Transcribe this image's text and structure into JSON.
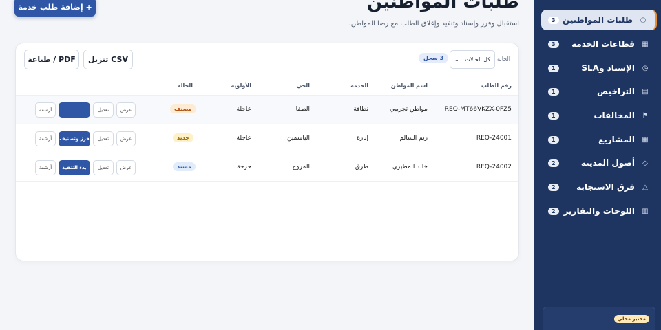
{
  "header": {
    "add_button": "+ إضافة طلب خدمة",
    "title": "طلبات المواطنين",
    "subtitle": "استقبال وفرز وإسناد وتنفيذ وإغلاق الطلب مع رضا المواطن."
  },
  "sidebar": {
    "items": [
      {
        "label": "طلبات المواطنين",
        "count": "3",
        "icon": "circle-icon",
        "glyph": "○"
      },
      {
        "label": "قطاعات الخدمة",
        "count": "3",
        "icon": "grid-icon",
        "glyph": "▦"
      },
      {
        "label": "الإسناد وSLA",
        "count": "1",
        "icon": "clock-icon",
        "glyph": "◷"
      },
      {
        "label": "التراخيص",
        "count": "1",
        "icon": "license-icon",
        "glyph": "▤"
      },
      {
        "label": "المخالفات",
        "count": "1",
        "icon": "flag-icon",
        "glyph": "⚑"
      },
      {
        "label": "المشاريع",
        "count": "1",
        "icon": "projects-icon",
        "glyph": "▦"
      },
      {
        "label": "أصول المدينة",
        "count": "2",
        "icon": "diamond-icon",
        "glyph": "◇"
      },
      {
        "label": "فرق الاستجابة",
        "count": "2",
        "icon": "triangle-icon",
        "glyph": "△"
      },
      {
        "label": "اللوحات والتقارير",
        "count": "2",
        "icon": "dashboard-icon",
        "glyph": "▥"
      }
    ],
    "lab_badge": "مختبر محلي"
  },
  "toolbar": {
    "print_pdf": "طباعة / PDF",
    "download_csv": "تنزيل CSV",
    "filter_label": "الحالة",
    "filter_value": "كل الحالات",
    "count_badge": "3 سجل"
  },
  "table": {
    "columns": [
      "رقم الطلب",
      "اسم المواطن",
      "الخدمة",
      "الحي",
      "الأولوية",
      "الحالة"
    ],
    "rows": [
      {
        "id": "REQ-MT66VKZX-0FZ5",
        "citizen": "مواطن تجريبي",
        "service": "نظافة",
        "district": "الصفا",
        "priority": "عاجلة",
        "status": "مصنف",
        "status_key": "classified",
        "primary_action": ""
      },
      {
        "id": "REQ-24001",
        "citizen": "ريم السالم",
        "service": "إنارة",
        "district": "الياسمين",
        "priority": "عاجلة",
        "status": "جديد",
        "status_key": "new",
        "primary_action": "فرز وتصنيف"
      },
      {
        "id": "REQ-24002",
        "citizen": "خالد المطيري",
        "service": "طرق",
        "district": "المروج",
        "priority": "حرجة",
        "status": "مسند",
        "status_key": "assigned",
        "primary_action": "بدء التنفيذ"
      }
    ],
    "actions": {
      "view": "عرض",
      "edit": "تعديل",
      "archive": "أرشفة"
    }
  },
  "colors": {
    "sidebar": "#1e3461",
    "primary": "#2f57a6",
    "accent": "#e98f2c"
  }
}
